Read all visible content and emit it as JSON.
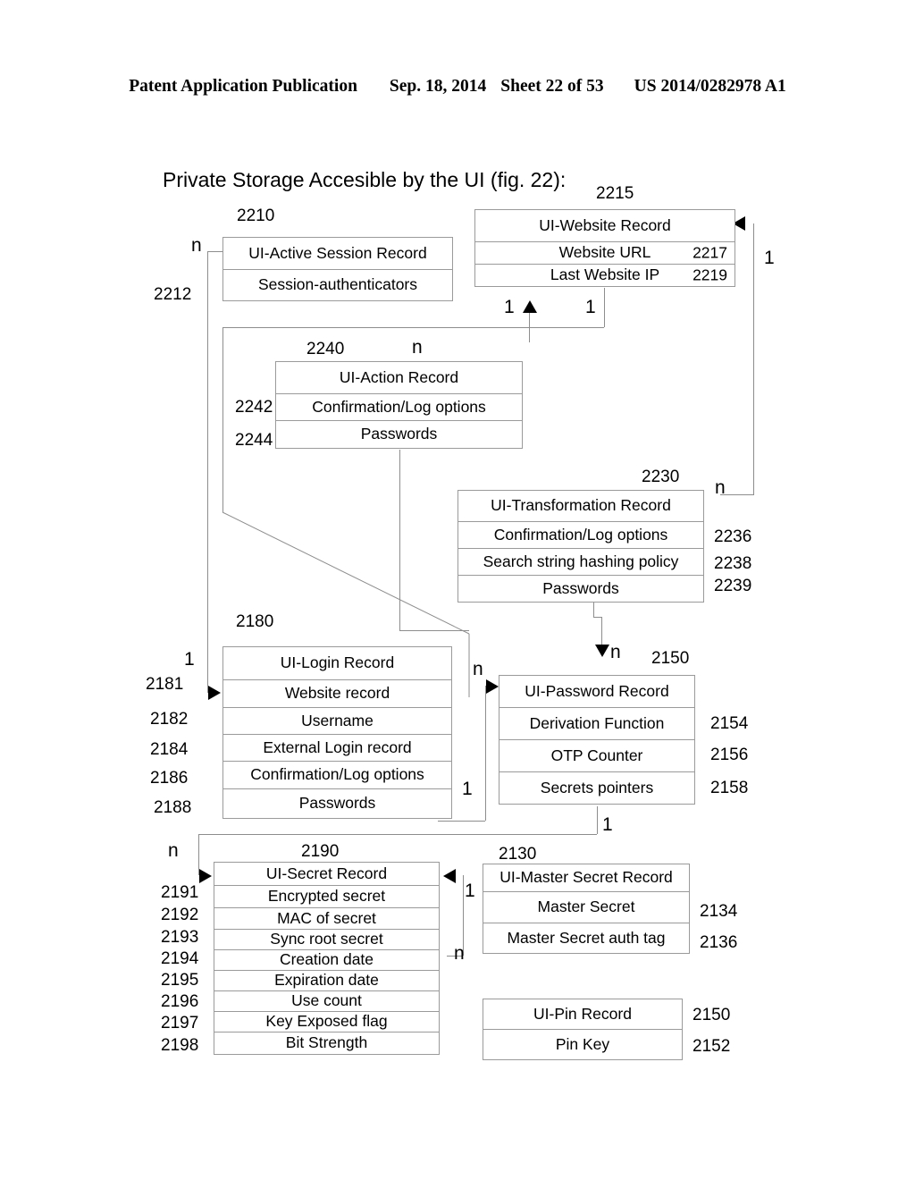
{
  "header": {
    "publication": "Patent Application Publication",
    "date": "Sep. 18, 2014",
    "sheet": "Sheet 22 of 53",
    "docnum": "US 2014/0282978 A1"
  },
  "figure": {
    "title": "Private Storage Accesible by the UI (fig. 22):"
  },
  "boxes": {
    "active_session": {
      "ref": "2210",
      "rows": [
        {
          "label": "UI-Active Session Record",
          "num": ""
        },
        {
          "label": "Session-authenticators",
          "num": "2212"
        }
      ]
    },
    "website": {
      "ref": "2215",
      "rows": [
        {
          "label": "UI-Website Record",
          "num": ""
        },
        {
          "label": "Website URL",
          "num": "2217"
        },
        {
          "label": "Last Website IP",
          "num": "2219"
        }
      ]
    },
    "action": {
      "ref": "2240",
      "rows": [
        {
          "label": "UI-Action Record",
          "num": ""
        },
        {
          "label": "Confirmation/Log options",
          "num": "2242"
        },
        {
          "label": "Passwords",
          "num": "2244"
        }
      ]
    },
    "transformation": {
      "ref": "2230",
      "rows": [
        {
          "label": "UI-Transformation Record",
          "num": ""
        },
        {
          "label": "Confirmation/Log options",
          "num": "2236"
        },
        {
          "label": "Search string hashing policy",
          "num": "2238"
        },
        {
          "label": "Passwords",
          "num": "2239"
        }
      ]
    },
    "login": {
      "ref": "2180",
      "rows": [
        {
          "label": "UI-Login Record",
          "num": ""
        },
        {
          "label": "Website record",
          "num": "2181"
        },
        {
          "label": "Username",
          "num": "2182"
        },
        {
          "label": "External Login record",
          "num": "2184"
        },
        {
          "label": "Confirmation/Log options",
          "num": "2186"
        },
        {
          "label": "Passwords",
          "num": "2188"
        }
      ]
    },
    "password": {
      "ref": "2150",
      "rows": [
        {
          "label": "UI-Password Record",
          "num": ""
        },
        {
          "label": "Derivation Function",
          "num": "2154"
        },
        {
          "label": "OTP Counter",
          "num": "2156"
        },
        {
          "label": "Secrets pointers",
          "num": "2158"
        }
      ]
    },
    "secret": {
      "ref": "2190",
      "rows": [
        {
          "label": "UI-Secret Record",
          "num": ""
        },
        {
          "label": "Encrypted secret",
          "num": "2191"
        },
        {
          "label": "MAC of secret",
          "num": "2192"
        },
        {
          "label": "Sync root secret",
          "num": "2193"
        },
        {
          "label": "Creation date",
          "num": "2194"
        },
        {
          "label": "Expiration date",
          "num": "2195"
        },
        {
          "label": "Use count",
          "num": "2196"
        },
        {
          "label": "Key Exposed flag",
          "num": "2197"
        },
        {
          "label": "Bit Strength",
          "num": "2198"
        }
      ]
    },
    "master_secret": {
      "ref": "2130",
      "rows": [
        {
          "label": "UI-Master Secret Record",
          "num": ""
        },
        {
          "label": "Master Secret",
          "num": "2134"
        },
        {
          "label": "Master Secret auth tag",
          "num": "2136"
        }
      ]
    },
    "pin": {
      "ref": "",
      "rows": [
        {
          "label": "UI-Pin Record",
          "num": "2150"
        },
        {
          "label": "Pin Key",
          "num": "2152"
        }
      ]
    }
  },
  "cardinalities": {
    "session_n": "n",
    "session_login_one": "1",
    "website_right_one": "1",
    "action_n": "n",
    "action_to_website_one": "1",
    "website_bottom_one": "1",
    "transformation_n": "n",
    "transformation_to_password_n": "n",
    "login_to_password_n": "n",
    "login_passwords_one": "1",
    "password_bottom_one": "1",
    "secret_n": "n",
    "secret_master_one": "1",
    "secret_master_n": "n"
  }
}
